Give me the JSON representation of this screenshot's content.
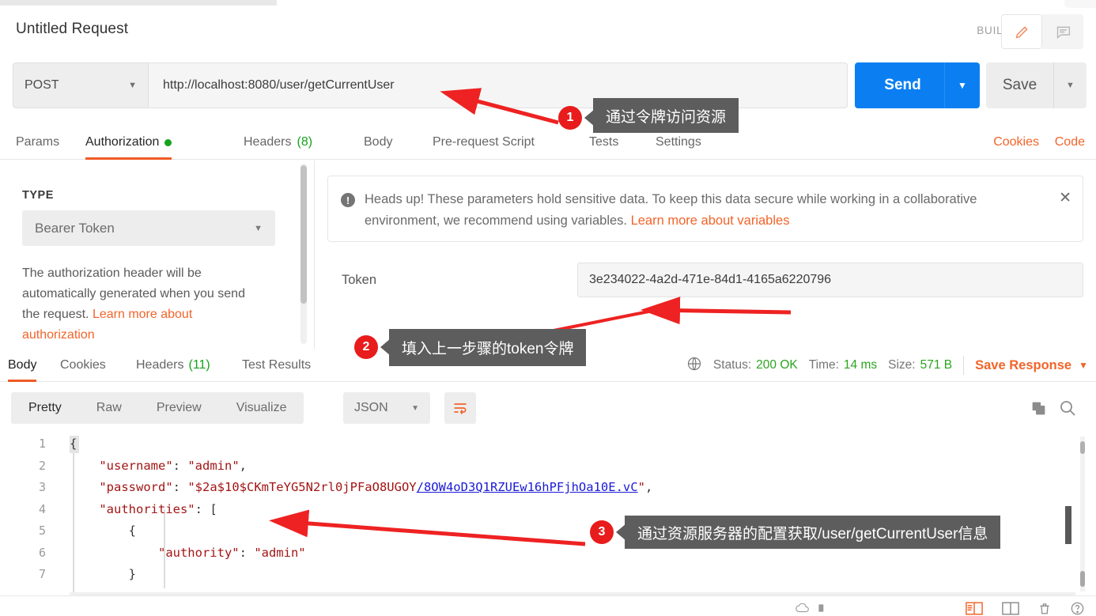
{
  "window": {
    "request_title": "Untitled Request",
    "build_label": "BUILD"
  },
  "url_bar": {
    "method": "POST",
    "method_caret": "▼",
    "url": "http://localhost:8080/user/getCurrentUser",
    "send_label": "Send",
    "send_caret": "▼",
    "save_label": "Save",
    "save_caret": "▼"
  },
  "request_tabs": {
    "items": [
      {
        "label": "Params",
        "active": false,
        "badge": ""
      },
      {
        "label": "Authorization",
        "active": true,
        "badge": "dot"
      },
      {
        "label": "Headers",
        "active": false,
        "badge": "(8)"
      },
      {
        "label": "Body",
        "active": false,
        "badge": ""
      },
      {
        "label": "Pre-request Script",
        "active": false,
        "badge": ""
      },
      {
        "label": "Tests",
        "active": false,
        "badge": ""
      },
      {
        "label": "Settings",
        "active": false,
        "badge": ""
      }
    ],
    "cookies": "Cookies",
    "code": "Code"
  },
  "auth": {
    "type_label": "TYPE",
    "type_value": "Bearer Token",
    "type_caret": "▼",
    "description_text": "The authorization header will be automatically generated when you send the request. ",
    "description_link": "Learn more about authorization",
    "notice_icon": "!",
    "notice_text": "Heads up! These parameters hold sensitive data. To keep this data secure while working in a collaborative environment, we recommend using variables. ",
    "notice_link": "Learn more about variables",
    "notice_close": "✕",
    "token_label": "Token",
    "token_value": "3e234022-4a2d-471e-84d1-4165a6220796"
  },
  "response_tabs": {
    "items": [
      {
        "label": "Body",
        "active": true,
        "badge": ""
      },
      {
        "label": "Cookies",
        "active": false,
        "badge": ""
      },
      {
        "label": "Headers",
        "active": false,
        "badge": "(11)"
      },
      {
        "label": "Test Results",
        "active": false,
        "badge": ""
      }
    ]
  },
  "status": {
    "globe_icon": "globe-icon",
    "status_label": "Status:",
    "status_value": "200 OK",
    "time_label": "Time:",
    "time_value": "14 ms",
    "size_label": "Size:",
    "size_value": "571 B",
    "save_response": "Save Response",
    "save_response_caret": "▼"
  },
  "viewer": {
    "modes": [
      {
        "label": "Pretty",
        "active": true
      },
      {
        "label": "Raw",
        "active": false
      },
      {
        "label": "Preview",
        "active": false
      },
      {
        "label": "Visualize",
        "active": false
      }
    ],
    "format": "JSON",
    "format_caret": "▼",
    "wrap_icon": "word-wrap-icon",
    "copy_icon": "copy-icon",
    "search_icon": "search-icon"
  },
  "code": {
    "line_numbers": [
      "1",
      "2",
      "3",
      "4",
      "5",
      "6",
      "7"
    ],
    "lines": [
      {
        "indent": 0,
        "segments": [
          {
            "t": "{",
            "c": "p"
          }
        ]
      },
      {
        "indent": 1,
        "segments": [
          {
            "t": "\"username\"",
            "c": "k"
          },
          {
            "t": ": ",
            "c": "p"
          },
          {
            "t": "\"admin\"",
            "c": "s"
          },
          {
            "t": ",",
            "c": "p"
          }
        ]
      },
      {
        "indent": 1,
        "segments": [
          {
            "t": "\"password\"",
            "c": "k"
          },
          {
            "t": ": ",
            "c": "p"
          },
          {
            "t": "\"$2a$10$CKmTeYG5N2rl0jPFaO8UGOY",
            "c": "s"
          },
          {
            "t": "/8OW4oD3Q1RZUEw16hPFjhOa10E.vC",
            "c": "ul"
          },
          {
            "t": "\"",
            "c": "s"
          },
          {
            "t": ",",
            "c": "p"
          }
        ]
      },
      {
        "indent": 1,
        "segments": [
          {
            "t": "\"authorities\"",
            "c": "k"
          },
          {
            "t": ": [",
            "c": "p"
          }
        ]
      },
      {
        "indent": 2,
        "segments": [
          {
            "t": "{",
            "c": "p"
          }
        ]
      },
      {
        "indent": 3,
        "segments": [
          {
            "t": "\"authority\"",
            "c": "k"
          },
          {
            "t": ": ",
            "c": "p"
          },
          {
            "t": "\"admin\"",
            "c": "s"
          }
        ]
      },
      {
        "indent": 2,
        "segments": [
          {
            "t": "}",
            "c": "p"
          }
        ]
      }
    ]
  },
  "annotations": [
    {
      "number": "1",
      "text": "通过令牌访问资源"
    },
    {
      "number": "2",
      "text": "填入上一步骤的token令牌"
    },
    {
      "number": "3",
      "text": "通过资源服务器的配置获取/user/getCurrentUser信息"
    }
  ],
  "colors": {
    "accent_orange": "#f2642a",
    "send_blue": "#0b7ff2",
    "success_green": "#2aa51e",
    "annotation_red": "#e81c1c",
    "callout_gray": "#5d5d5d"
  }
}
